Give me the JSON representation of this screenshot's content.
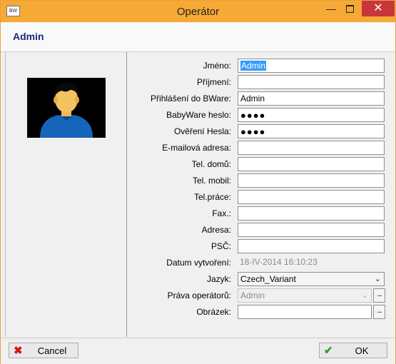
{
  "window": {
    "title": "Operátor",
    "app_icon_text": "BW",
    "minimize_glyph": "—",
    "close_glyph": "✕"
  },
  "header": {
    "title": "Admin"
  },
  "avatar": {
    "icon": "user-avatar-icon"
  },
  "form": {
    "rows": [
      {
        "label": "Jméno:",
        "value": "Admin",
        "type": "text",
        "selected": true
      },
      {
        "label": "Příjmení:",
        "value": "",
        "type": "text"
      },
      {
        "label": "Přihlášení do BWare:",
        "value": "Admin",
        "type": "text"
      },
      {
        "label": "BabyWare heslo:",
        "value": "●●●●",
        "type": "password"
      },
      {
        "label": "Ověření Hesla:",
        "value": "●●●●",
        "type": "password"
      },
      {
        "label": "E-mailová adresa:",
        "value": "",
        "type": "text"
      },
      {
        "label": "Tel. domů:",
        "value": "",
        "type": "text"
      },
      {
        "label": "Tel. mobil:",
        "value": "",
        "type": "text"
      },
      {
        "label": "Tel.práce:",
        "value": "",
        "type": "text"
      },
      {
        "label": "Fax.:",
        "value": "",
        "type": "text"
      },
      {
        "label": "Adresa:",
        "value": "",
        "type": "text"
      },
      {
        "label": "PSČ:",
        "value": "",
        "type": "text"
      },
      {
        "label": "Datum vytvoření:",
        "value": "18-IV-2014 16:10:23",
        "type": "readonly"
      },
      {
        "label": "Jazyk:",
        "value": "Czech_Variant",
        "type": "select"
      },
      {
        "label": "Práva operátorů:",
        "value": "Admin",
        "type": "select-disabled",
        "button": "..."
      },
      {
        "label": "Obrázek:",
        "value": "",
        "type": "text",
        "button": "..."
      }
    ]
  },
  "buttons": {
    "cancel": {
      "label": "Cancel",
      "icon": "x-icon",
      "icon_glyph": "✖",
      "color": "#d4161a"
    },
    "ok": {
      "label": "OK",
      "icon": "checkmark-icon",
      "icon_glyph": "✔",
      "color": "#2e9b2e"
    }
  },
  "colors": {
    "titlebar": "#f6a934",
    "close": "#c7373a",
    "header_title": "#1a2b7a",
    "selection": "#3399ff"
  }
}
